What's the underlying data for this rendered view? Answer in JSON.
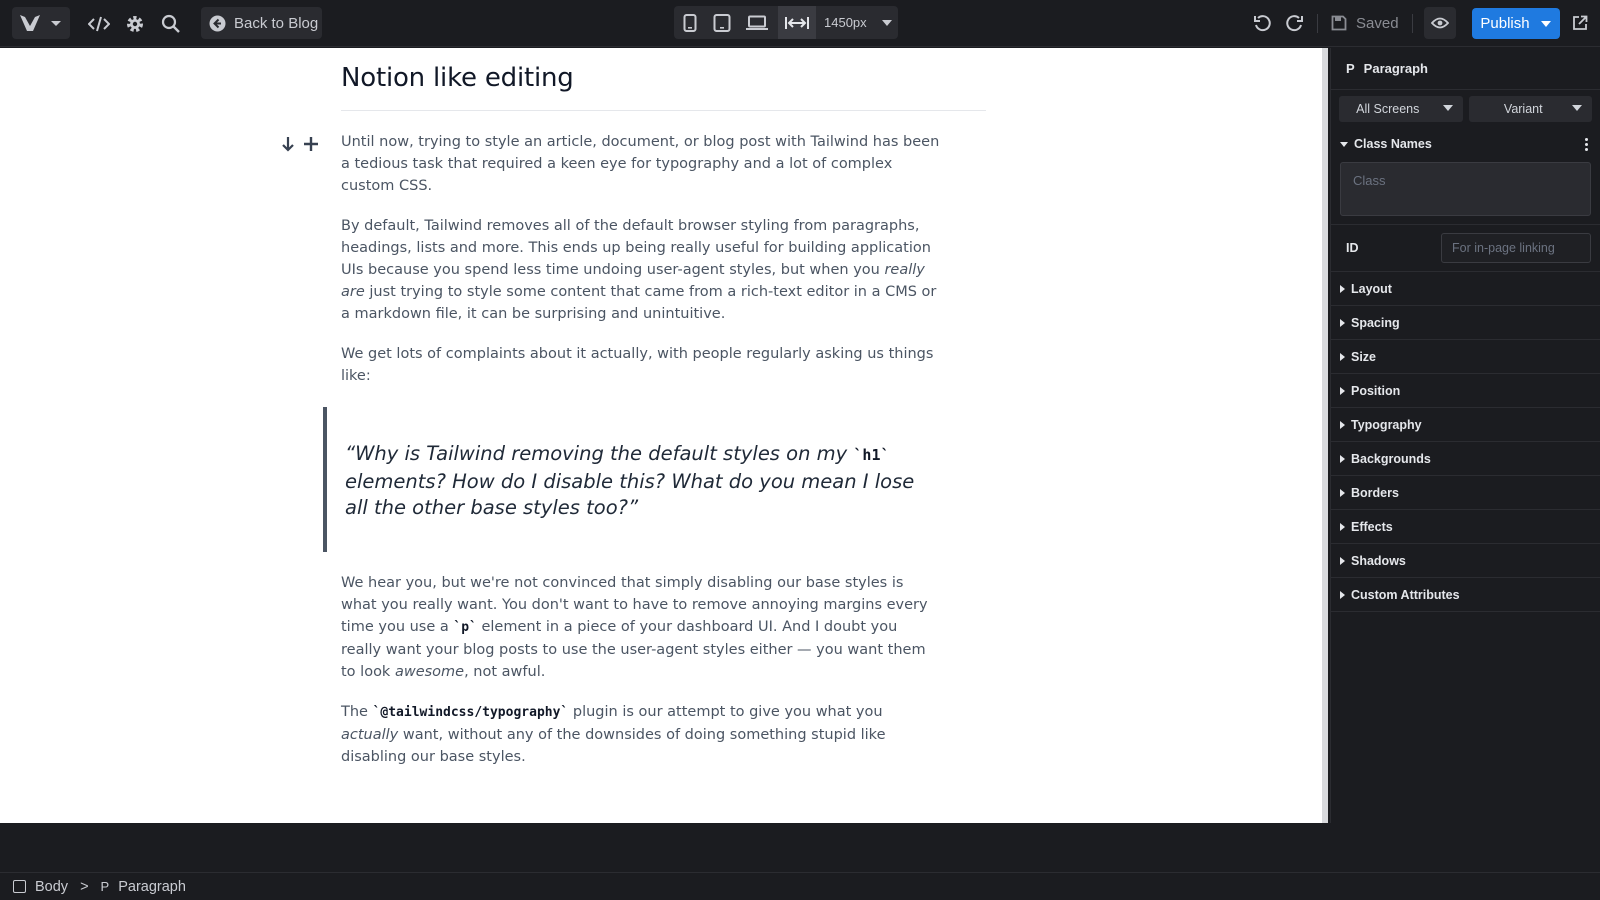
{
  "toolbar": {
    "back_label": "Back to Blog",
    "width_readout": "1450px",
    "saved_label": "Saved",
    "publish_label": "Publish"
  },
  "article": {
    "title": "Notion like editing",
    "p1": "Until now, trying to style an article, document, or blog post with Tailwind has been a tedious task that required a keen eye for typography and a lot of complex custom CSS.",
    "p2_a": "By default, Tailwind removes all of the default browser styling from paragraphs, headings, lists and more. This ends up being really useful for building application UIs because you spend less time undoing user-agent styles, but when you ",
    "p2_em": "really are",
    "p2_b": " just trying to style some content that came from a rich-text editor in a CMS or a markdown file, it can be surprising and unintuitive.",
    "p3": "We get lots of complaints about it actually, with people regularly asking us things like:",
    "quote_a": "“Why is Tailwind removing the default styles on my ",
    "quote_code": "`h1`",
    "quote_b": " elements? How do I disable this? What do you mean I lose all the other base styles too?”",
    "p4_a": "We hear you, but we're not convinced that simply disabling our base styles is what you really want. You don't want to have to remove annoying margins every time you use a ",
    "p4_code": "`p`",
    "p4_b": " element in a piece of your dashboard UI. And I doubt you really want your blog posts to use the user-agent styles either — you want them to look ",
    "p4_em": "awesome",
    "p4_c": ", not awful.",
    "p5_a": "The ",
    "p5_code": "`@tailwindcss/typography`",
    "p5_b": " plugin is our attempt to give you what you ",
    "p5_em": "actually",
    "p5_c": " want, without any of the downsides of doing something stupid like disabling our base styles."
  },
  "panel": {
    "element_tag": "P",
    "element_name": "Paragraph",
    "screens_label": "All Screens",
    "variant_label": "Variant",
    "class_names_title": "Class Names",
    "class_placeholder": "Class",
    "id_label": "ID",
    "id_placeholder": "For in-page linking",
    "sections": [
      "Layout",
      "Spacing",
      "Size",
      "Position",
      "Typography",
      "Backgrounds",
      "Borders",
      "Effects",
      "Shadows",
      "Custom Attributes"
    ]
  },
  "breadcrumb": {
    "root": "Body",
    "separator": ">",
    "tag": "P",
    "current": "Paragraph"
  }
}
